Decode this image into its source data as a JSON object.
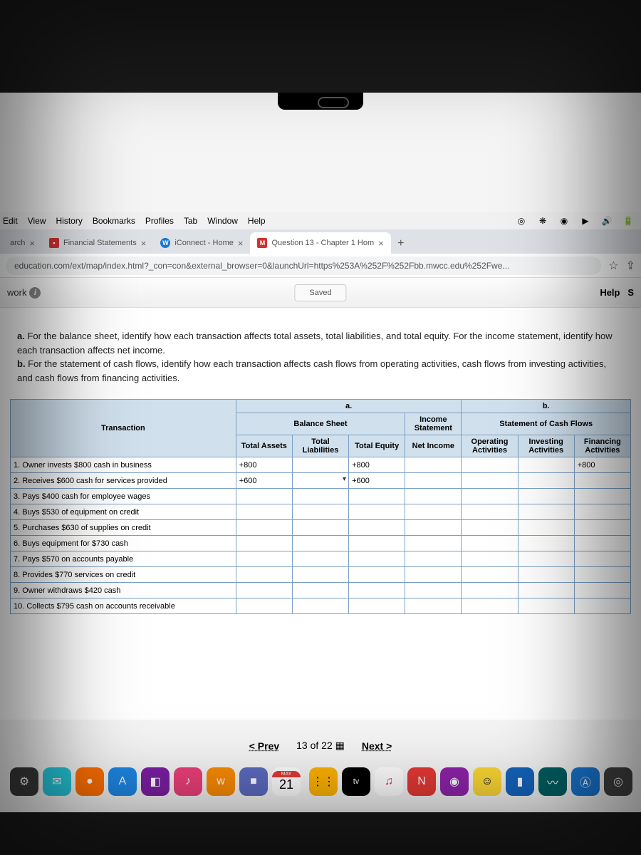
{
  "menubar": {
    "items": [
      "Edit",
      "View",
      "History",
      "Bookmarks",
      "Profiles",
      "Tab",
      "Window",
      "Help"
    ]
  },
  "tabs": {
    "t0": "arch",
    "t1": "Financial Statements",
    "t2": "iConnect - Home",
    "t3": "Question 13 - Chapter 1 Hom"
  },
  "url": "education.com/ext/map/index.html?_con=con&external_browser=0&launchUrl=https%253A%252F%252Fbb.mwcc.edu%252Fwe...",
  "toolbar": {
    "work": "work",
    "saved": "Saved",
    "help": "Help",
    "s": "S"
  },
  "instructions": {
    "a_bold": "a.",
    "a_text": " For the balance sheet, identify how each transaction affects total assets, total liabilities, and total equity. For the income statement, identify how each transaction affects net income.",
    "b_bold": "b.",
    "b_text": " For the statement of cash flows, identify how each transaction affects cash flows from operating activities, cash flows from investing activities, and cash flows from financing activities."
  },
  "headers": {
    "a": "a.",
    "b": "b.",
    "transaction": "Transaction",
    "balance_sheet": "Balance Sheet",
    "income_stmt": "Income Statement",
    "scf": "Statement of Cash Flows",
    "total_assets": "Total Assets",
    "total_liab": "Total Liabilities",
    "total_equity": "Total Equity",
    "net_income": "Net Income",
    "operating": "Operating Activities",
    "investing": "Investing Activities",
    "financing": "Financing Activities"
  },
  "rows": [
    {
      "txn": "1. Owner invests $800 cash in business",
      "assets": "+800",
      "liab": "",
      "equity": "+800",
      "net": "",
      "op": "",
      "inv": "",
      "fin": "+800"
    },
    {
      "txn": "2. Receives $600 cash for services provided",
      "assets": "+600",
      "liab": "",
      "equity": "+600",
      "net": "",
      "op": "",
      "inv": "",
      "fin": ""
    },
    {
      "txn": "3. Pays $400 cash for employee wages",
      "assets": "",
      "liab": "",
      "equity": "",
      "net": "",
      "op": "",
      "inv": "",
      "fin": ""
    },
    {
      "txn": "4. Buys $530 of equipment on credit",
      "assets": "",
      "liab": "",
      "equity": "",
      "net": "",
      "op": "",
      "inv": "",
      "fin": ""
    },
    {
      "txn": "5. Purchases $630 of supplies on credit",
      "assets": "",
      "liab": "",
      "equity": "",
      "net": "",
      "op": "",
      "inv": "",
      "fin": ""
    },
    {
      "txn": "6. Buys equipment for $730 cash",
      "assets": "",
      "liab": "",
      "equity": "",
      "net": "",
      "op": "",
      "inv": "",
      "fin": ""
    },
    {
      "txn": "7. Pays $570 on accounts payable",
      "assets": "",
      "liab": "",
      "equity": "",
      "net": "",
      "op": "",
      "inv": "",
      "fin": ""
    },
    {
      "txn": "8. Provides $770 services on credit",
      "assets": "",
      "liab": "",
      "equity": "",
      "net": "",
      "op": "",
      "inv": "",
      "fin": ""
    },
    {
      "txn": "9. Owner withdraws $420 cash",
      "assets": "",
      "liab": "",
      "equity": "",
      "net": "",
      "op": "",
      "inv": "",
      "fin": ""
    },
    {
      "txn": "10. Collects $795 cash on accounts receivable",
      "assets": "",
      "liab": "",
      "equity": "",
      "net": "",
      "op": "",
      "inv": "",
      "fin": ""
    }
  ],
  "pager": {
    "prev": "Prev",
    "pos": "13 of 22",
    "next": "Next"
  },
  "calendar": {
    "month": "MAY",
    "day": "21"
  },
  "dock_tv": "tv",
  "dock_aa": "Aa"
}
